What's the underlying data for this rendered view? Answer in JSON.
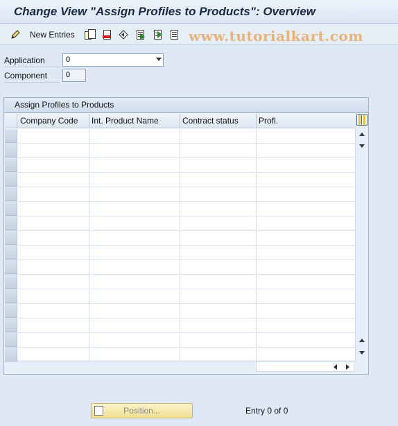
{
  "window": {
    "title": "Change View \"Assign Profiles to Products\": Overview"
  },
  "toolbar": {
    "new_entries_label": "New Entries",
    "icons": [
      "edit-pencil-icon",
      "copy-as-icon",
      "delete-icon",
      "undo-change-icon",
      "select-all-icon",
      "select-block-icon",
      "deselect-all-icon"
    ]
  },
  "watermark": "www.tutorialkart.com",
  "form": {
    "application": {
      "label": "Application",
      "value": "0"
    },
    "component": {
      "label": "Component",
      "value": "0"
    }
  },
  "table": {
    "title": "Assign Profiles to Products",
    "columns": [
      "Company Code",
      "Int. Product Name",
      "Contract status",
      "Profl."
    ],
    "rows": [
      [
        "",
        "",
        "",
        ""
      ],
      [
        "",
        "",
        "",
        ""
      ],
      [
        "",
        "",
        "",
        ""
      ],
      [
        "",
        "",
        "",
        ""
      ],
      [
        "",
        "",
        "",
        ""
      ],
      [
        "",
        "",
        "",
        ""
      ],
      [
        "",
        "",
        "",
        ""
      ],
      [
        "",
        "",
        "",
        ""
      ],
      [
        "",
        "",
        "",
        ""
      ],
      [
        "",
        "",
        "",
        ""
      ],
      [
        "",
        "",
        "",
        ""
      ],
      [
        "",
        "",
        "",
        ""
      ],
      [
        "",
        "",
        "",
        ""
      ],
      [
        "",
        "",
        "",
        ""
      ],
      [
        "",
        "",
        "",
        ""
      ],
      [
        "",
        "",
        "",
        ""
      ]
    ]
  },
  "footer": {
    "position_button_label": "Position...",
    "entry_status": "Entry 0 of 0"
  },
  "colors": {
    "background": "#dfe9f5",
    "watermark": "#e9b27a",
    "position_button": "#f3e7a8"
  }
}
